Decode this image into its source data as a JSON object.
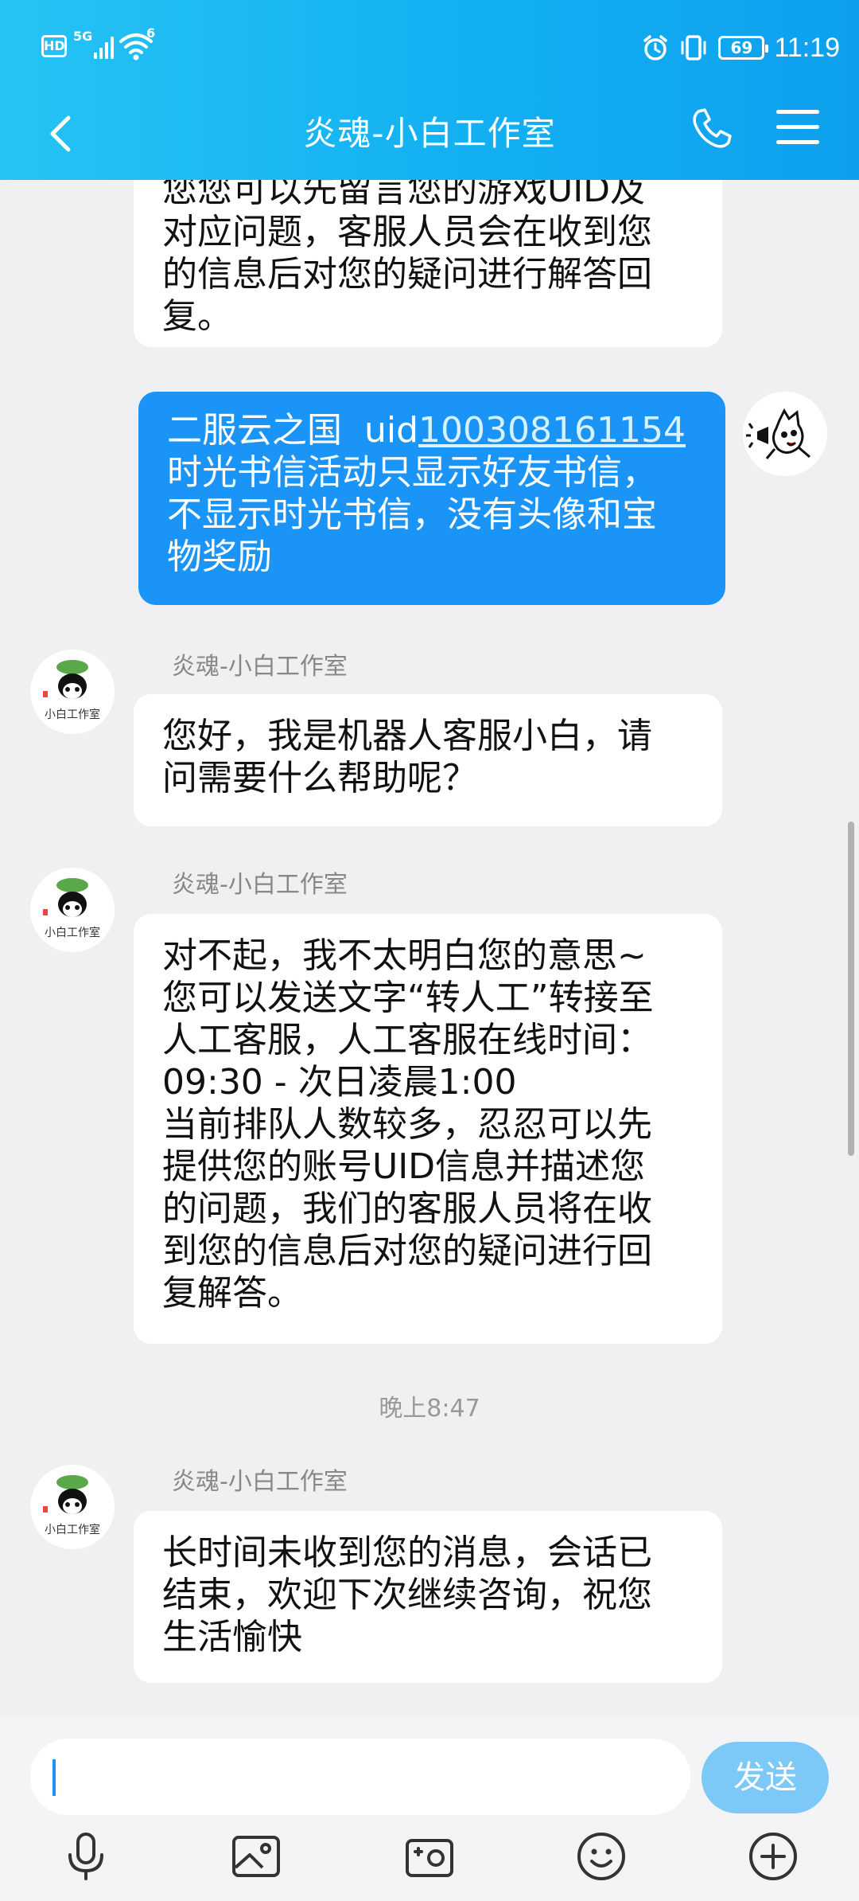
{
  "status_bar": {
    "hd": "HD",
    "network": "5G",
    "wifi_badge": "6",
    "battery": "69",
    "time": "11:19"
  },
  "header": {
    "title": "炎魂-小白工作室"
  },
  "messages": {
    "top_partial": "您您可以先留言您的游戏UID及\n对应问题，客服人员会在收到您\n的信息后对您的疑问进行解答回\n复。",
    "mine_1_prefix": "二服云之国  uid",
    "mine_1_uid": "100308161154",
    "mine_1_rest": "\n时光书信活动只显示好友书信，\n不显示时光书信，没有头像和宝\n物奖励",
    "sender_1": "炎魂-小白工作室",
    "reply_1": "您好，我是机器人客服小白，请\n问需要什么帮助呢？",
    "sender_2": "炎魂-小白工作室",
    "reply_2": "对不起，我不太明白您的意思~\n您可以发送文字“转人工”转接至\n人工客服，人工客服在线时间：\n09:30 - 次日凌晨1:00\n当前排队人数较多，忍忍可以先\n提供您的账号UID信息并描述您\n的问题，我们的客服人员将在收\n到您的信息后对您的疑问进行回\n复解答。",
    "time_label": "晚上8:47",
    "sender_3": "炎魂-小白工作室",
    "reply_3": "长时间未收到您的消息，会话已\n结束，欢迎下次继续咨询，祝您\n生活愉快"
  },
  "input": {
    "send_label": "发送"
  },
  "avatar_text": "小白工作室"
}
